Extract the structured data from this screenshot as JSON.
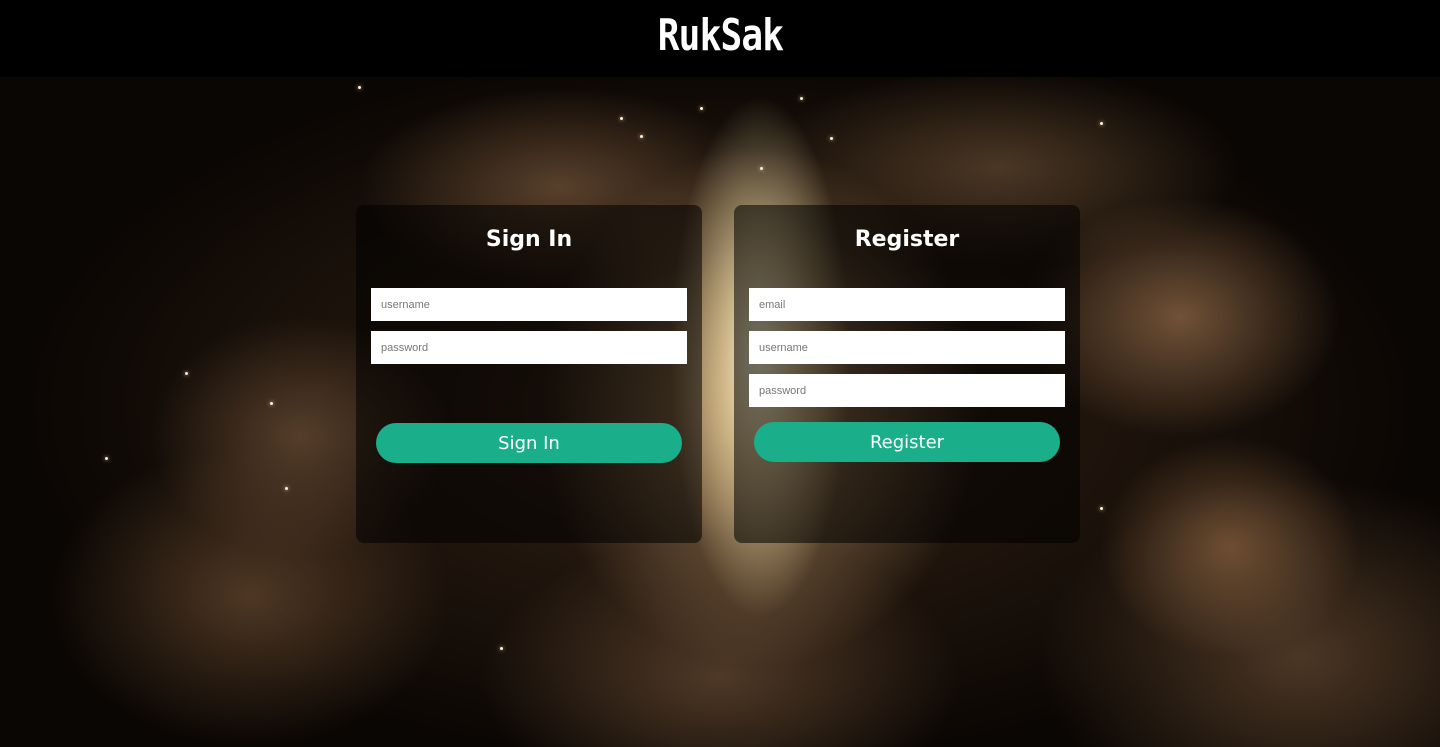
{
  "header": {
    "brand": "RukSak"
  },
  "sign_in": {
    "title": "Sign In",
    "username_placeholder": "username",
    "password_placeholder": "password",
    "button_label": "Sign In"
  },
  "register": {
    "title": "Register",
    "email_placeholder": "email",
    "username_placeholder": "username",
    "password_placeholder": "password",
    "button_label": "Register"
  },
  "colors": {
    "accent": "#1aae8a",
    "header_bg": "#000000",
    "panel_bg": "rgba(0,0,0,0.55)"
  }
}
